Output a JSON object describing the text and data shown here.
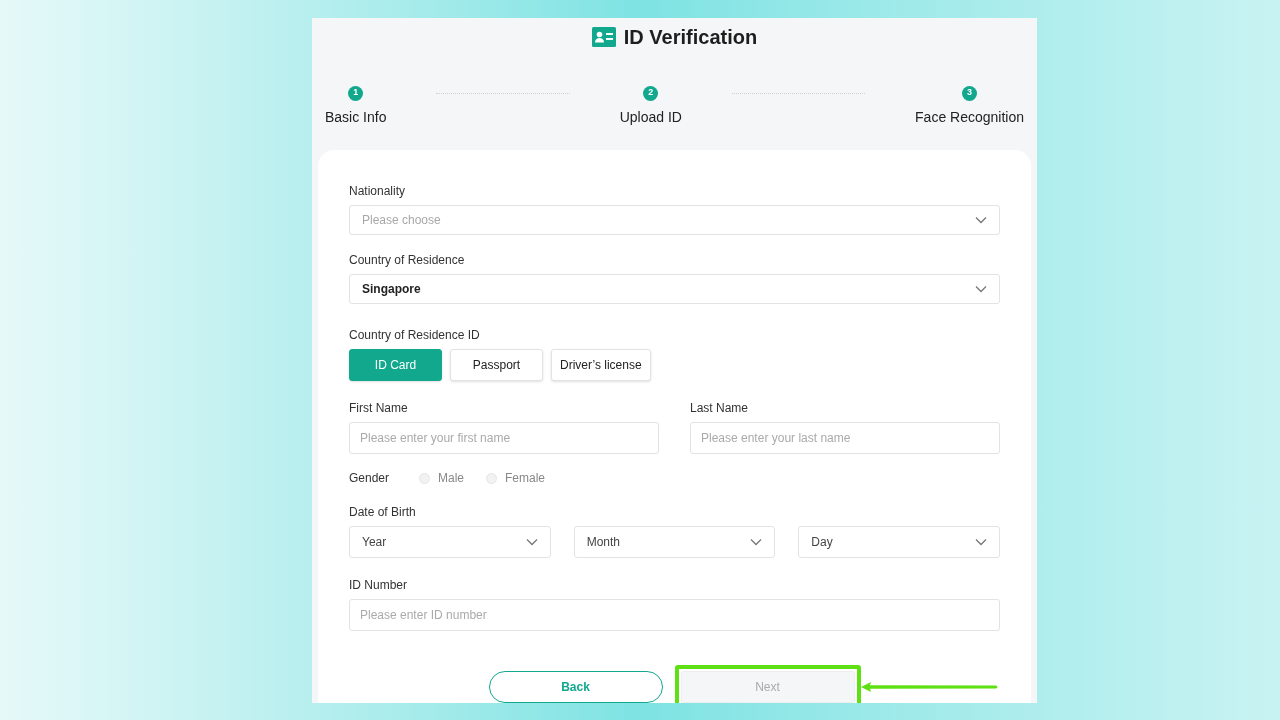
{
  "title": "ID Verification",
  "steps": [
    {
      "number": "1",
      "label": "Basic Info"
    },
    {
      "number": "2",
      "label": "Upload ID"
    },
    {
      "number": "3",
      "label": "Face Recognition"
    }
  ],
  "form": [
    {
      "kind": "select",
      "label": "Nationality",
      "placeholder": "Please choose"
    },
    {
      "kind": "select",
      "label": "Country of Residence",
      "value": "Singapore"
    },
    {
      "kind": "choice",
      "label": "Country of Residence ID",
      "options": [
        {
          "label": "ID Card",
          "selected": true
        },
        {
          "label": "Passport",
          "selected": false
        },
        {
          "label": "Driver’s license",
          "selected": false
        }
      ]
    },
    {
      "kind": "pair",
      "fields": [
        {
          "label": "First Name",
          "placeholder": "Please enter your first name"
        },
        {
          "label": "Last Name",
          "placeholder": "Please enter your last name"
        }
      ]
    },
    {
      "kind": "radio",
      "label": "Gender",
      "options": [
        {
          "label": "Male",
          "selected": false
        },
        {
          "label": "Female",
          "selected": false
        }
      ]
    },
    {
      "kind": "date",
      "label": "Date of Birth",
      "selects": [
        "Year",
        "Month",
        "Day"
      ]
    },
    {
      "kind": "text",
      "label": "ID Number",
      "placeholder": "Please enter ID number"
    }
  ],
  "buttons": [
    {
      "kind": "back",
      "label": "Back",
      "disabled": false
    },
    {
      "kind": "next",
      "label": "Next",
      "disabled": true,
      "highlighted": true
    }
  ]
}
